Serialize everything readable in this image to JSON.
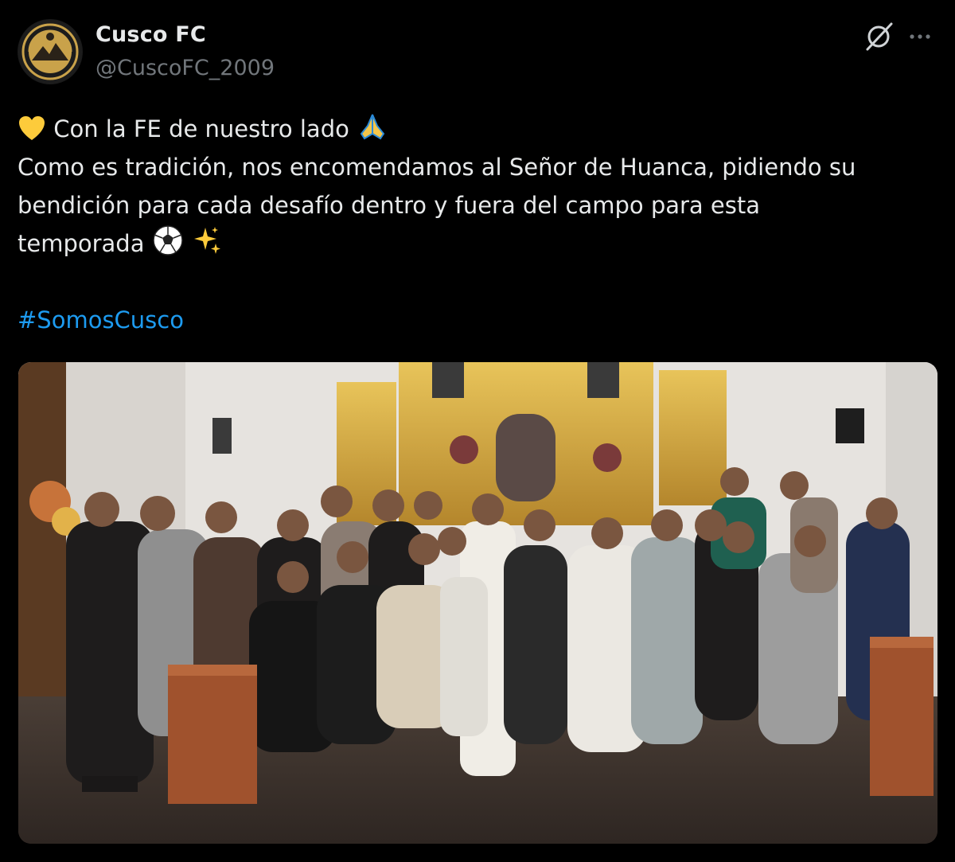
{
  "post": {
    "author": {
      "display_name": "Cusco FC",
      "handle": "@CuscoFC_2009"
    },
    "actions": {
      "grok_icon": "grok-icon",
      "more_icon": "more-icon"
    },
    "text": {
      "line1": "Con la FE de nuestro lado",
      "line2": "Como es tradición, nos encomendamos al Señor de Huanca, pidiendo su",
      "line3": "bendición para cada desafío dentro y fuera del campo para esta",
      "line4": "temporada",
      "hashtag": "#SomosCusco"
    },
    "emojis": [
      "yellow-heart",
      "folded-hands",
      "soccer-ball",
      "sparkles"
    ],
    "media": {
      "type": "photo",
      "alt": ""
    }
  },
  "colors": {
    "background": "#000000",
    "text": "#e7e9ea",
    "secondary": "#71767b",
    "link": "#1d9bf0",
    "logo_gold": "#c9a24a"
  }
}
